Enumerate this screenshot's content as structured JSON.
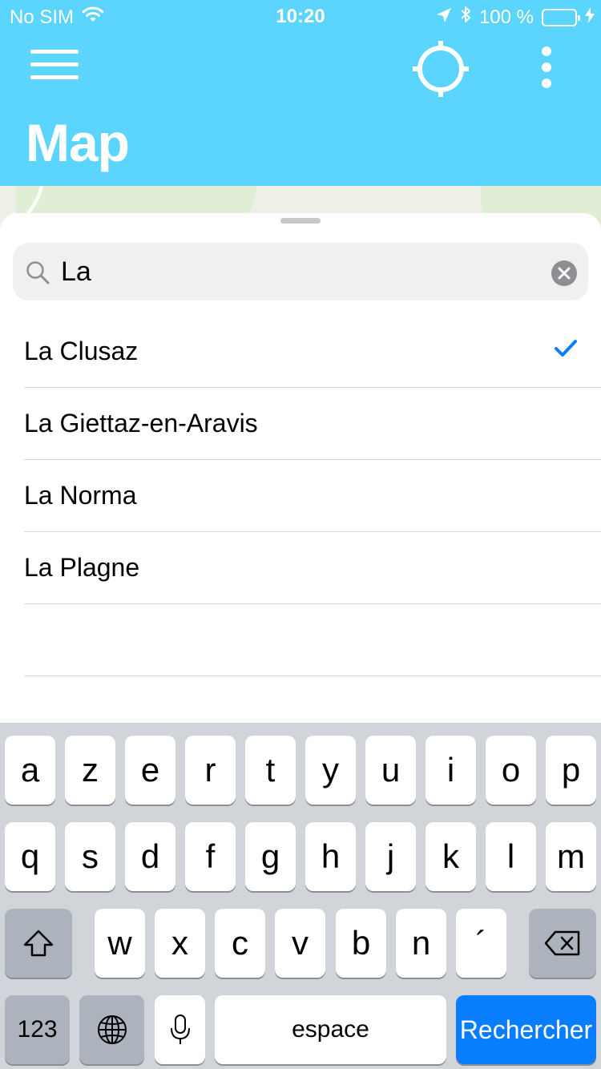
{
  "status_bar": {
    "carrier": "No SIM",
    "time": "10:20",
    "battery_percent": "100 %",
    "battery_level": 1.0,
    "icons": [
      "wifi-icon",
      "location-arrow-icon",
      "bluetooth-icon",
      "battery-icon",
      "charging-bolt-icon"
    ]
  },
  "header": {
    "title": "Map",
    "background_color": "#5bd5fd",
    "buttons": [
      "menu-icon",
      "locate-crosshair-icon",
      "more-vertical-icon"
    ]
  },
  "search": {
    "value": "La",
    "icons": [
      "search-icon",
      "clear-icon"
    ]
  },
  "results": [
    {
      "label": "La Clusaz",
      "selected": true
    },
    {
      "label": "La Giettaz-en-Aravis",
      "selected": false
    },
    {
      "label": "La Norma",
      "selected": false
    },
    {
      "label": "La Plagne",
      "selected": false
    }
  ],
  "accent_color": "#087eff",
  "keyboard": {
    "row1": [
      "a",
      "z",
      "e",
      "r",
      "t",
      "y",
      "u",
      "i",
      "o",
      "p"
    ],
    "row2": [
      "q",
      "s",
      "d",
      "f",
      "g",
      "h",
      "j",
      "k",
      "l",
      "m"
    ],
    "row3": [
      "w",
      "x",
      "c",
      "v",
      "b",
      "n",
      "´"
    ],
    "numbers_label": "123",
    "space_label": "espace",
    "search_label": "Rechercher"
  }
}
